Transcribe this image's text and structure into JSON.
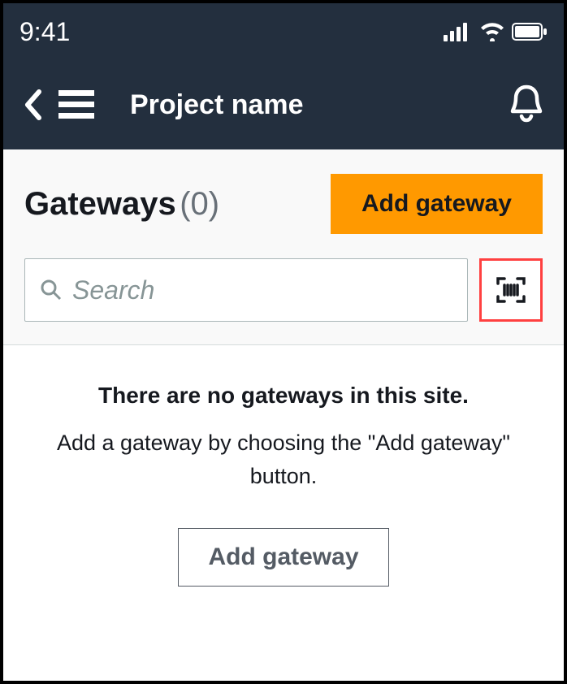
{
  "statusBar": {
    "time": "9:41"
  },
  "header": {
    "title": "Project name"
  },
  "page": {
    "title": "Gateways",
    "count": "(0)",
    "addButtonPrimary": "Add gateway",
    "searchPlaceholder": "Search"
  },
  "emptyState": {
    "title": "There are no gateways in this site.",
    "description": "Add a gateway by choosing the \"Add gateway\" button.",
    "addButtonSecondary": "Add gateway"
  }
}
